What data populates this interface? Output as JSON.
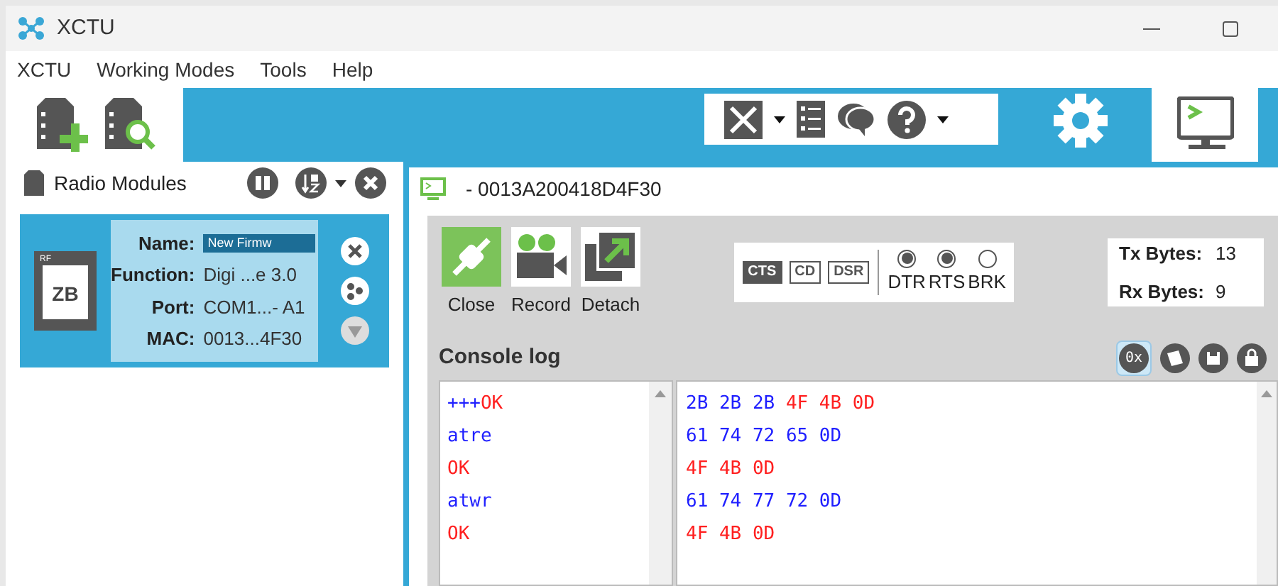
{
  "window": {
    "title": "XCTU"
  },
  "menu": [
    "XCTU",
    "Working Modes",
    "Tools",
    "Help"
  ],
  "radio_modules": {
    "title": "Radio Modules",
    "module": {
      "badge_top": "RF",
      "badge": "ZB",
      "selected": true,
      "fields": [
        {
          "label": "Name:",
          "value": "New Firmw",
          "kind": "tag"
        },
        {
          "label": "Function:",
          "value": "Digi ...e 3.0",
          "kind": "text"
        },
        {
          "label": "Port:",
          "value": "COM1...- A1",
          "kind": "text"
        },
        {
          "label": "MAC:",
          "value": "0013...4F30",
          "kind": "text"
        }
      ]
    }
  },
  "console": {
    "title": "- 0013A200418D4F30",
    "actions": [
      {
        "label": "Close",
        "kind": "close",
        "active": true
      },
      {
        "label": "Record",
        "kind": "record",
        "active": false
      },
      {
        "label": "Detach",
        "kind": "detach",
        "active": false
      }
    ],
    "signals": [
      {
        "label": "CTS",
        "on": true
      },
      {
        "label": "CD",
        "on": false
      },
      {
        "label": "DSR",
        "on": false
      }
    ],
    "lines": [
      {
        "label": "DTR",
        "checked": true
      },
      {
        "label": "RTS",
        "checked": true
      },
      {
        "label": "BRK",
        "checked": false
      }
    ],
    "tx_label": "Tx Bytes:",
    "tx_value": "13",
    "rx_label": "Rx Bytes:",
    "rx_value": "9",
    "log_title": "Console log",
    "hex_toggle": {
      "label": "0x",
      "selected": true
    },
    "ascii_lines": [
      [
        {
          "text": "+++",
          "color": "#2020ff"
        },
        {
          "text": "OK",
          "color": "#ff2020"
        }
      ],
      [
        {
          "text": "atre",
          "color": "#2020ff"
        }
      ],
      [
        {
          "text": "OK",
          "color": "#ff2020"
        }
      ],
      [
        {
          "text": "atwr",
          "color": "#2020ff"
        }
      ],
      [
        {
          "text": "OK",
          "color": "#ff2020"
        }
      ]
    ],
    "hex_lines": [
      [
        {
          "text": "2B 2B 2B",
          "color": "#2020ff"
        },
        {
          "text": "4F 4B 0D",
          "color": "#ff2020"
        }
      ],
      [
        {
          "text": "61 74 72 65 0D",
          "color": "#2020ff"
        }
      ],
      [
        {
          "text": "4F 4B 0D",
          "color": "#ff2020"
        }
      ],
      [
        {
          "text": "61 74 77 72 0D",
          "color": "#2020ff"
        }
      ],
      [
        {
          "text": "4F 4B 0D",
          "color": "#ff2020"
        }
      ]
    ]
  }
}
